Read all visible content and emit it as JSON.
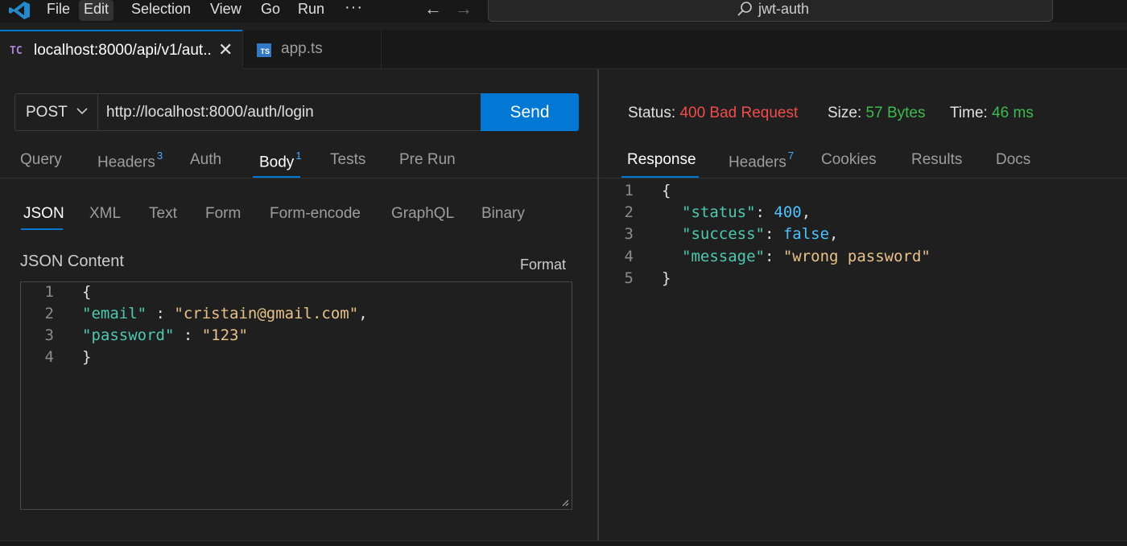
{
  "titlebar": {
    "menu": [
      "File",
      "Edit",
      "Selection",
      "View",
      "Go",
      "Run"
    ],
    "more": "···",
    "back_arrow": "←",
    "forward_arrow": "→",
    "search_text": "jwt-auth"
  },
  "tabs": [
    {
      "icon": "TC",
      "label": "localhost:8000/api/v1/aut..",
      "close": "✕"
    },
    {
      "icon": "TS",
      "label": "app.ts"
    }
  ],
  "request": {
    "method": "POST",
    "url": "http://localhost:8000/auth/login",
    "send_label": "Send"
  },
  "request_tabs": [
    {
      "label": "Query"
    },
    {
      "label": "Headers",
      "badge": "3"
    },
    {
      "label": "Auth"
    },
    {
      "label": "Body",
      "badge": "1"
    },
    {
      "label": "Tests"
    },
    {
      "label": "Pre Run"
    }
  ],
  "body_tabs": [
    "JSON",
    "XML",
    "Text",
    "Form",
    "Form-encode",
    "GraphQL",
    "Binary"
  ],
  "body_section": {
    "title": "JSON Content",
    "format_label": "Format"
  },
  "request_body": {
    "line_numbers": [
      "1",
      "2",
      "3",
      "4"
    ],
    "open_brace": "{",
    "email_key": "\"email\"",
    "email_sep": " : ",
    "email_value": "\"cristain@gmail.com\"",
    "comma": ",",
    "password_key": "\"password\"",
    "password_sep": " : ",
    "password_value": "\"123\"",
    "close_brace": "}"
  },
  "response_status": {
    "status_label": "Status:",
    "status_value": "400 Bad Request",
    "size_label": "Size:",
    "size_value": "57 Bytes",
    "time_label": "Time:",
    "time_value": "46 ms"
  },
  "response_tabs": [
    {
      "label": "Response"
    },
    {
      "label": "Headers",
      "badge": "7"
    },
    {
      "label": "Cookies"
    },
    {
      "label": "Results"
    },
    {
      "label": "Docs"
    }
  ],
  "response_body": {
    "line_numbers": [
      "1",
      "2",
      "3",
      "4",
      "5"
    ],
    "open_brace": "{",
    "status_key": "\"status\"",
    "status_value": "400",
    "success_key": "\"success\"",
    "success_value": "false",
    "message_key": "\"message\"",
    "message_value": "\"wrong password\"",
    "colon": ": ",
    "comma": ",",
    "close_brace": "}"
  },
  "colors": {
    "accent": "#0078d4",
    "error": "#f14c4c",
    "success": "#3fb950",
    "json_key": "#4ec9b0",
    "json_string": "#ce9178",
    "json_number": "#4fc1ff"
  }
}
